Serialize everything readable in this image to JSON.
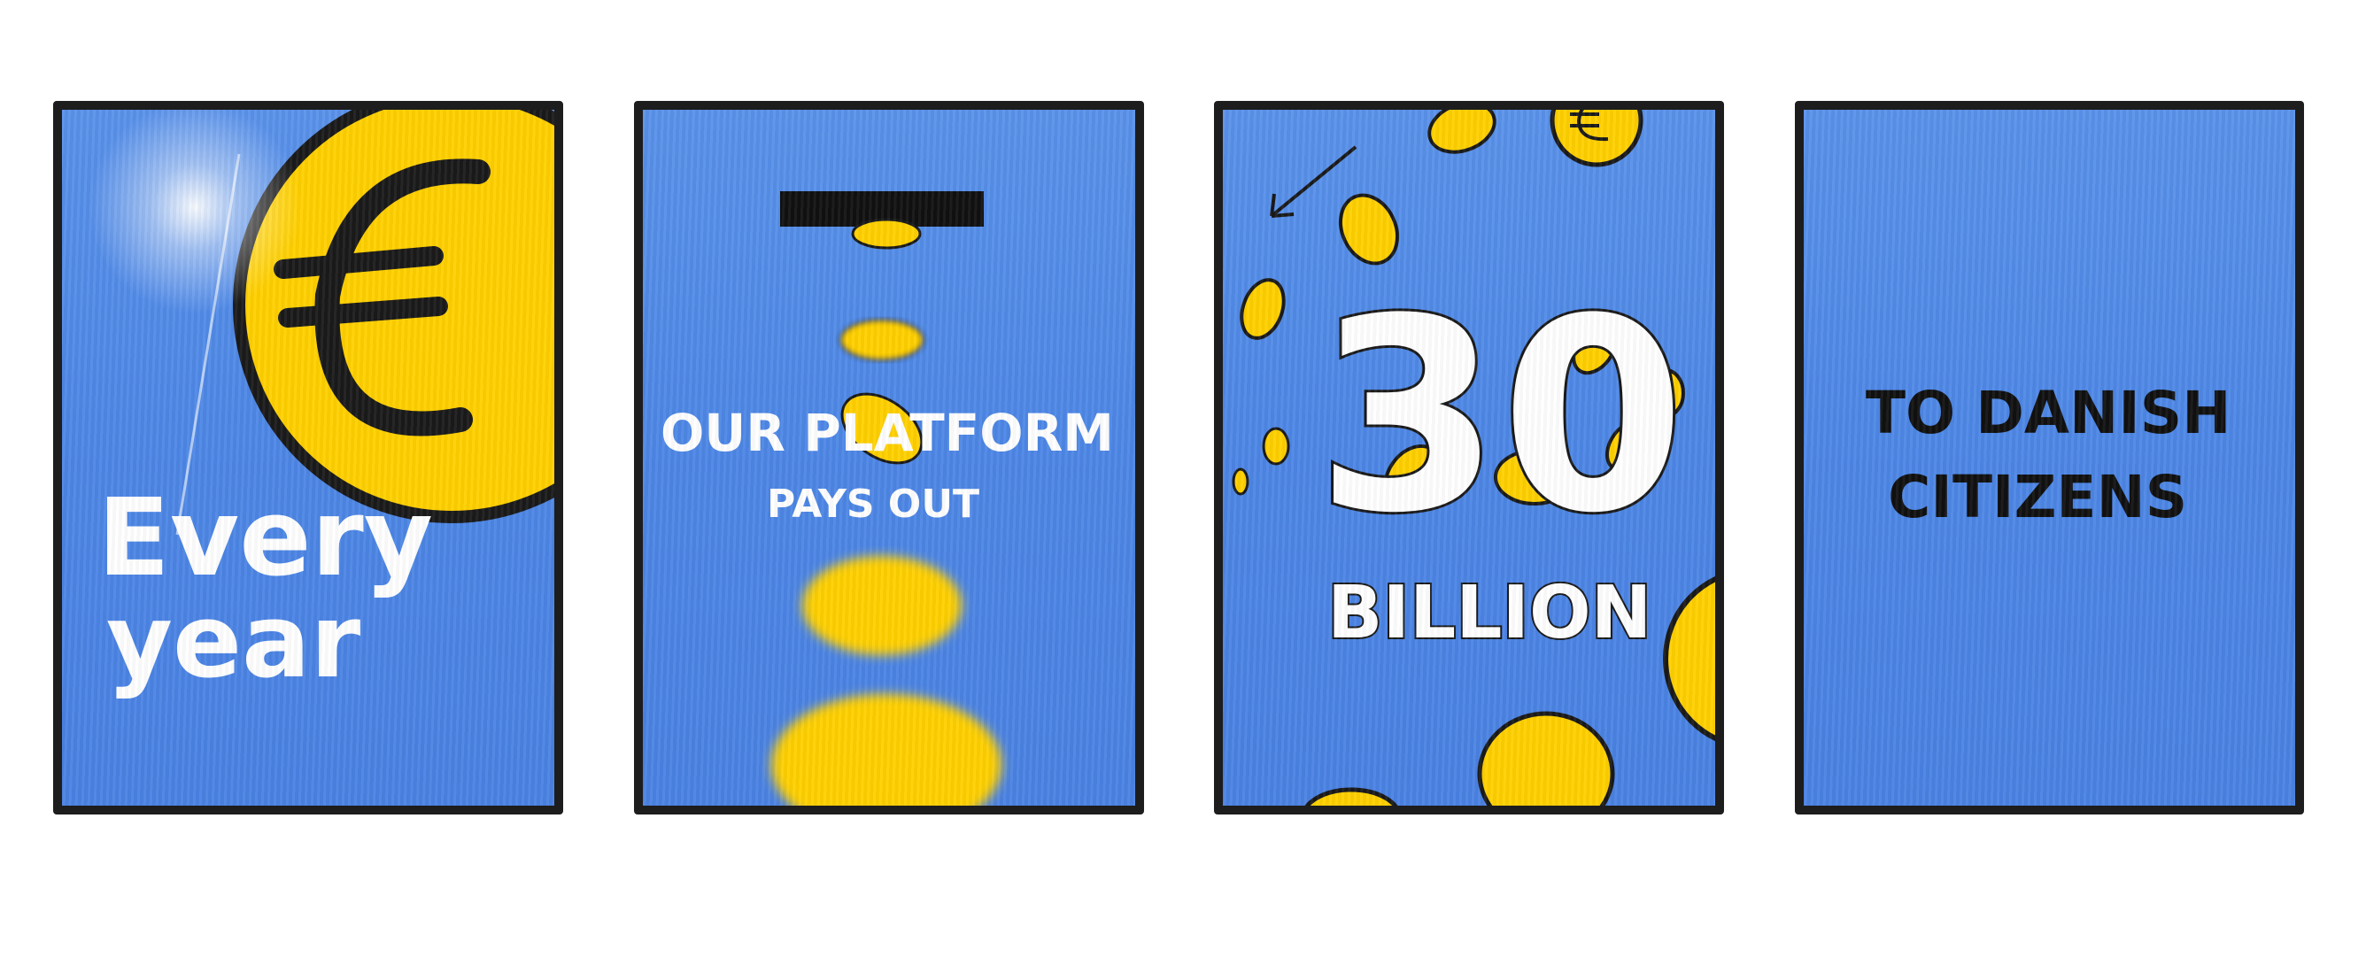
{
  "panels": [
    {
      "id": "panel-1",
      "lines": [
        "Every",
        "year"
      ],
      "icon": "euro-coin-icon"
    },
    {
      "id": "panel-2",
      "lines": [
        "OUR PLATFORM",
        "PAYS OUT"
      ],
      "icon": "coin-slot-icon"
    },
    {
      "id": "panel-3",
      "number": "30",
      "unit": "BILLION",
      "icon": "falling-coins-icon"
    },
    {
      "id": "panel-4",
      "lines": [
        "TO DANISH",
        "CITIZENS"
      ]
    }
  ],
  "colors": {
    "panel_blue": "#4d87e6",
    "coin_yellow": "#ffd000",
    "outline": "#1d1d1d",
    "text_white": "#ffffff"
  }
}
